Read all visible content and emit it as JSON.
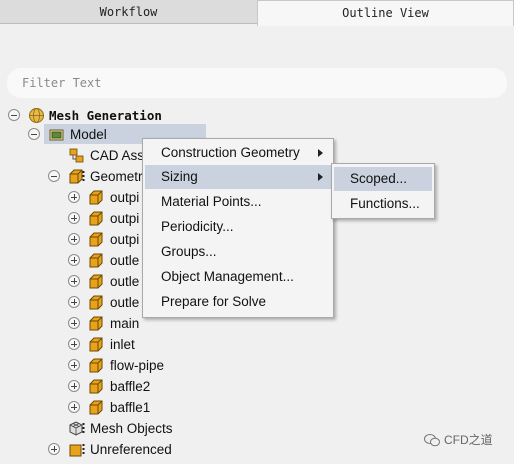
{
  "tabs": {
    "workflow": "Workflow",
    "outline": "Outline View"
  },
  "filter": {
    "placeholder": "Filter Text"
  },
  "tree": {
    "root": "Mesh Generation",
    "model": "Model",
    "cad_assemblies": "CAD Ass",
    "geometry": "Geometr",
    "children": [
      "outpi",
      "outpi",
      "outpi",
      "outle",
      "outle",
      "outle",
      "main",
      "inlet",
      "flow-pipe",
      "baffle2",
      "baffle1"
    ],
    "mesh_objects": "Mesh Objects",
    "unreferenced": "Unreferenced"
  },
  "context_menu": {
    "items": [
      "Construction Geometry",
      "Sizing",
      "Material Points...",
      "Periodicity...",
      "Groups...",
      "Object Management...",
      "Prepare for Solve"
    ],
    "hovered": "Sizing"
  },
  "submenu": {
    "items": [
      "Scoped...",
      "Functions..."
    ],
    "hovered": "Scoped..."
  },
  "watermark": {
    "text": "CFD之道"
  },
  "colors": {
    "selection": "#c9d2de",
    "folder": "#e8a21c",
    "folder_outline": "#6b4a00"
  }
}
